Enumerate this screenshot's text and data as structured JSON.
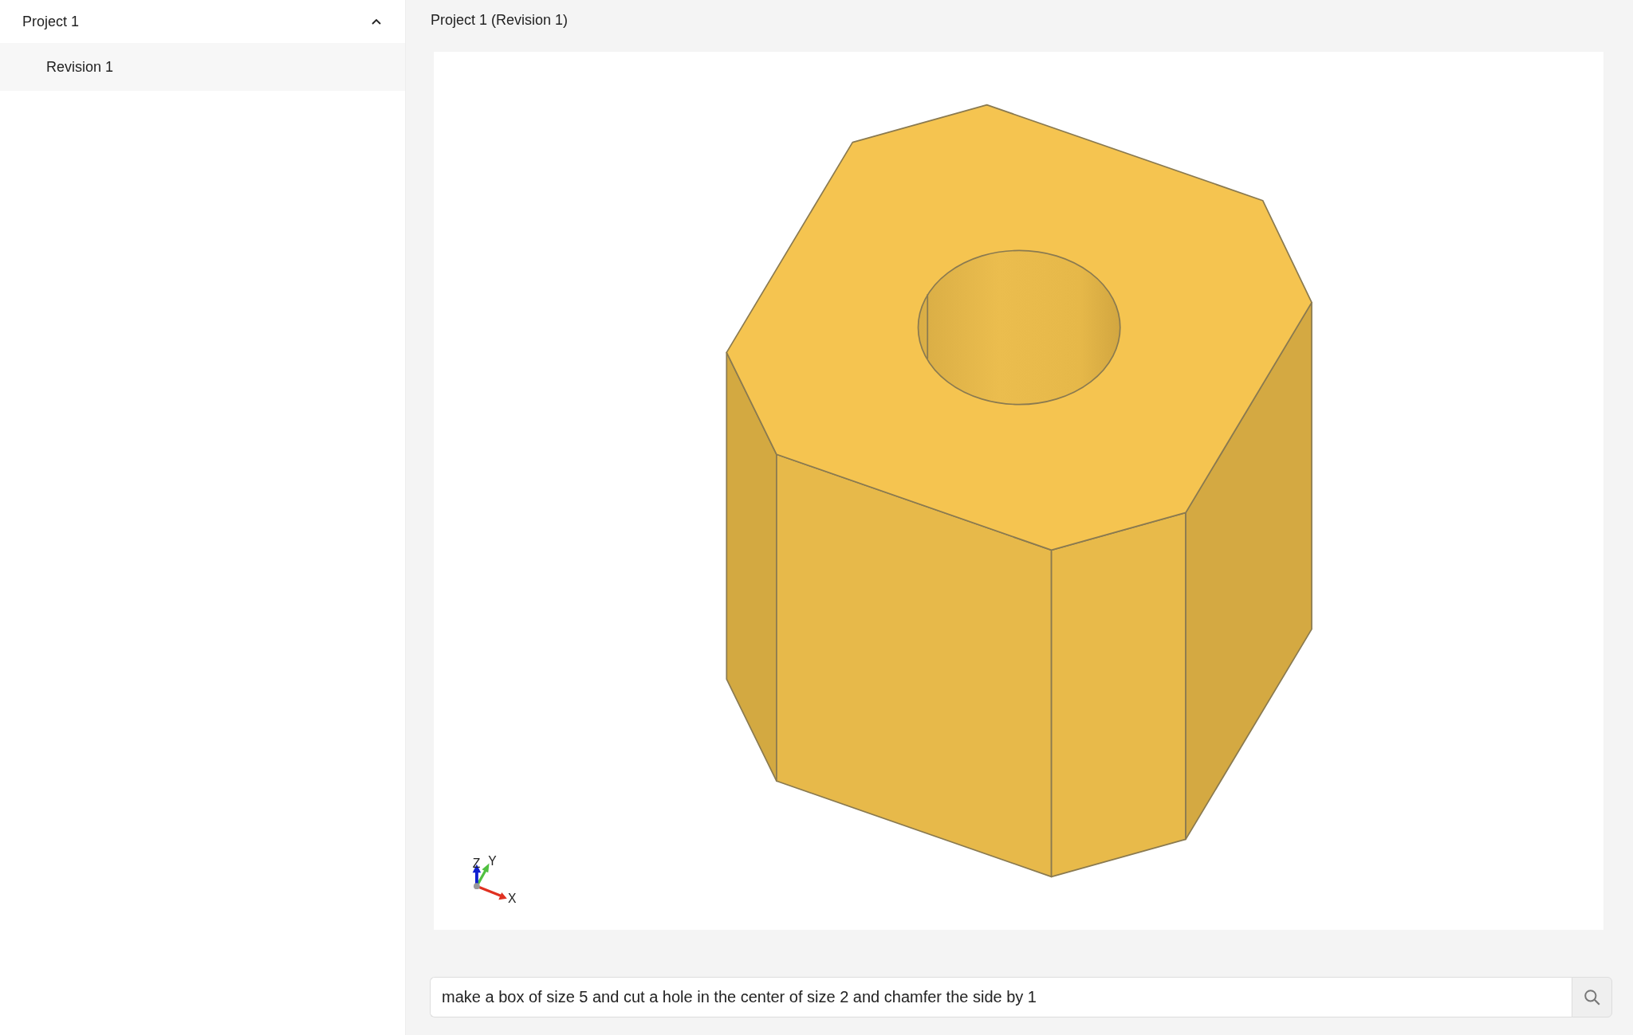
{
  "sidebar": {
    "projects": [
      {
        "label": "Project 1",
        "expanded": true,
        "revisions": [
          {
            "label": "Revision 1",
            "selected": true
          }
        ]
      }
    ]
  },
  "main": {
    "title": "Project 1 (Revision 1)",
    "viewport": {
      "axis_labels": {
        "x": "X",
        "y": "Y",
        "z": "Z"
      }
    },
    "prompt": {
      "value": "make a box of size 5 and cut a hole in the center of size 2 and chamfer the side by 1"
    }
  }
}
